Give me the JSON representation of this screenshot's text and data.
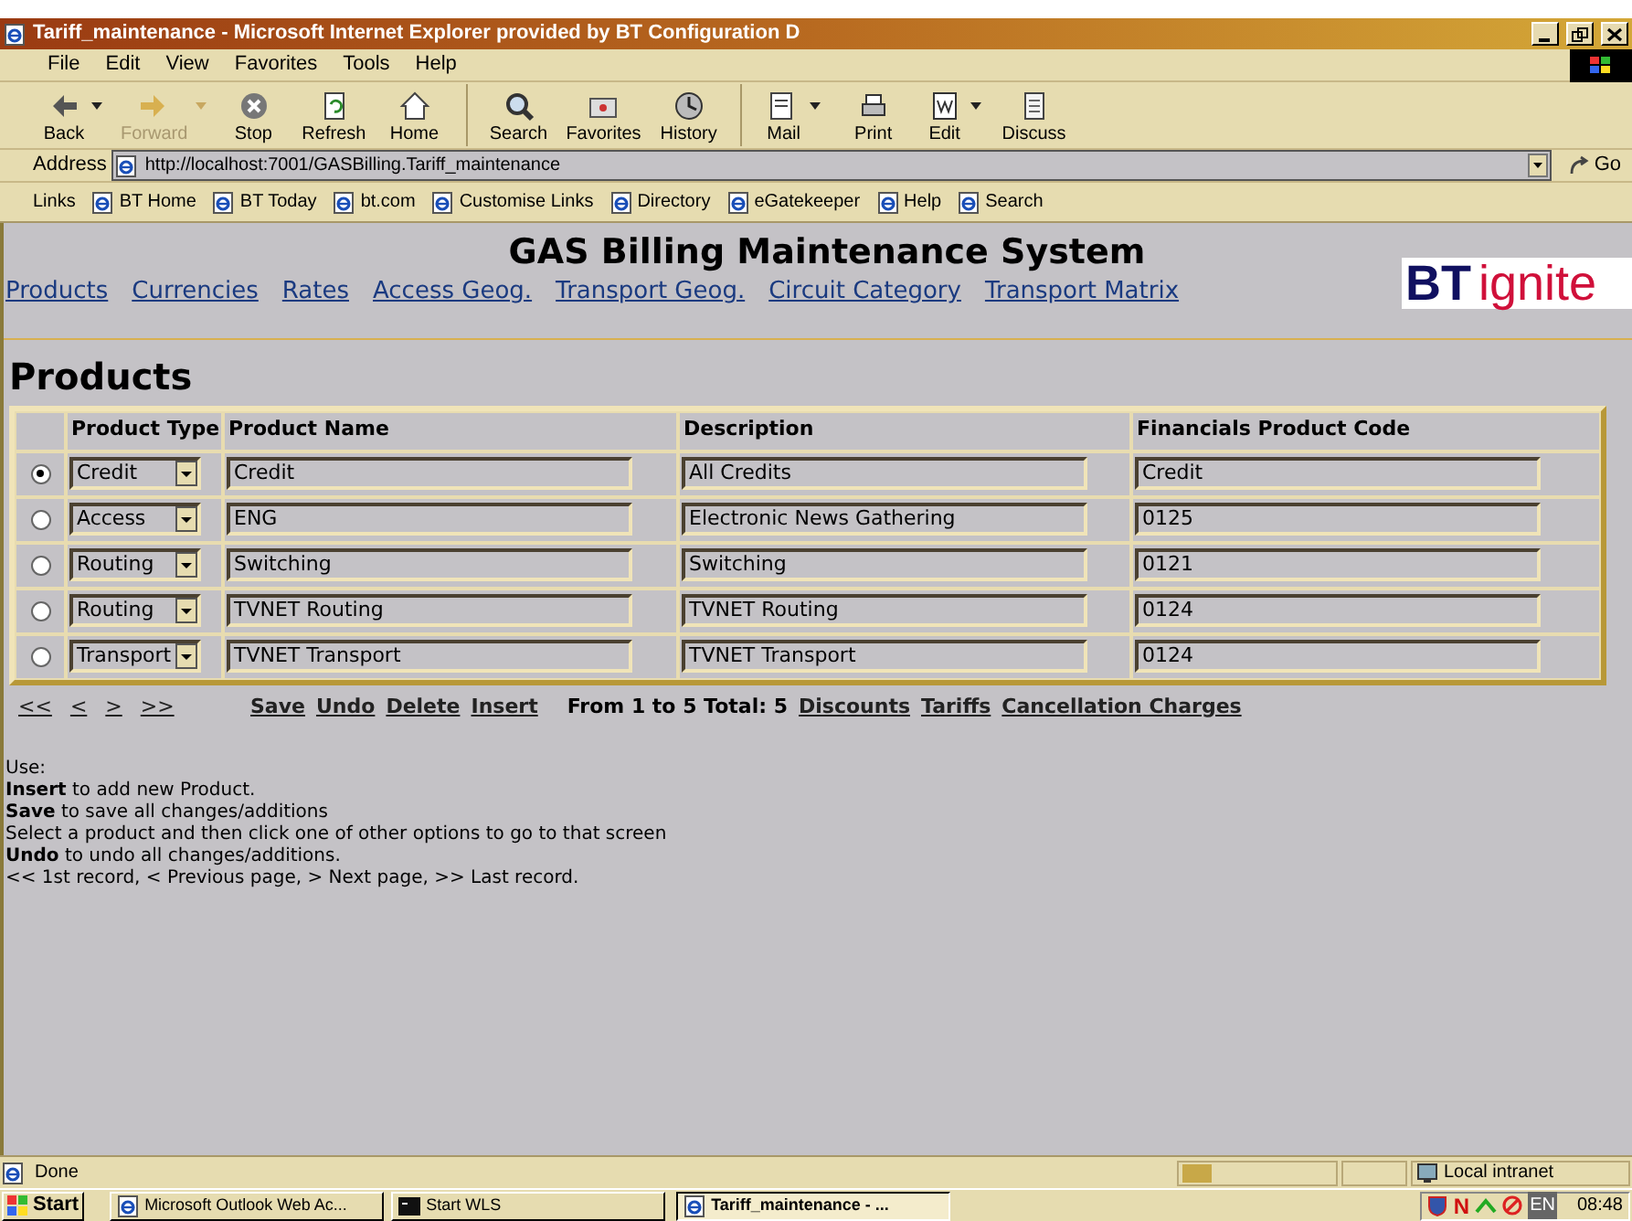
{
  "window": {
    "title": "Tariff_maintenance - Microsoft Internet Explorer provided by BT Configuration D"
  },
  "menu": [
    "File",
    "Edit",
    "View",
    "Favorites",
    "Tools",
    "Help"
  ],
  "toolbar": [
    [
      {
        "label": "Back",
        "disabled": false,
        "dropdown": true
      },
      {
        "label": "Forward",
        "disabled": true,
        "dropdown": true
      },
      {
        "label": "Stop",
        "disabled": false,
        "dropdown": false
      },
      {
        "label": "Refresh",
        "disabled": false,
        "dropdown": false
      },
      {
        "label": "Home",
        "disabled": false,
        "dropdown": false
      }
    ],
    [
      {
        "label": "Search",
        "disabled": false,
        "dropdown": false
      },
      {
        "label": "Favorites",
        "disabled": false,
        "dropdown": false
      },
      {
        "label": "History",
        "disabled": false,
        "dropdown": false
      }
    ],
    [
      {
        "label": "Mail",
        "disabled": false,
        "dropdown": true
      },
      {
        "label": "Print",
        "disabled": false,
        "dropdown": false
      },
      {
        "label": "Edit",
        "disabled": false,
        "dropdown": true
      },
      {
        "label": "Discuss",
        "disabled": false,
        "dropdown": false
      }
    ]
  ],
  "address": {
    "label": "Address",
    "value": "http://localhost:7001/GASBilling.Tariff_maintenance",
    "go": "Go"
  },
  "links": {
    "label": "Links",
    "items": [
      "BT Home",
      "BT Today",
      "bt.com",
      "Customise Links",
      "Directory",
      "eGatekeeper",
      "Help",
      "Search"
    ]
  },
  "page": {
    "heading": "GAS Billing Maintenance System",
    "nav": [
      "Products",
      "Currencies",
      "Rates",
      "Access Geog.",
      "Transport Geog.",
      "Circuit Category",
      "Transport Matrix"
    ],
    "logo": {
      "brand": "BT",
      "product": "ignite"
    },
    "section": "Products",
    "table": {
      "columns": [
        "Product Type",
        "Product Name",
        "Description",
        "Financials Product Code"
      ],
      "rows": [
        {
          "selected": true,
          "type": "Credit",
          "name": "Credit",
          "description": "All Credits",
          "code": "Credit"
        },
        {
          "selected": false,
          "type": "Access",
          "name": "ENG",
          "description": "Electronic News Gathering",
          "code": "0125"
        },
        {
          "selected": false,
          "type": "Routing",
          "name": "Switching",
          "description": "Switching",
          "code": "0121"
        },
        {
          "selected": false,
          "type": "Routing",
          "name": "TVNET Routing",
          "description": "TVNET Routing",
          "code": "0124"
        },
        {
          "selected": false,
          "type": "Transport",
          "name": "TVNET Transport",
          "description": "TVNET Transport",
          "code": "0124"
        }
      ]
    },
    "pager": [
      "<<",
      "<",
      ">",
      ">>"
    ],
    "actions": [
      "Save",
      "Undo",
      "Delete",
      "Insert"
    ],
    "record_info": "From 1 to 5 Total: 5",
    "related": [
      "Discounts",
      "Tariffs",
      "Cancellation Charges"
    ],
    "help": [
      "Use:",
      "**Insert** to add new Product.",
      "**Save** to save all changes/additions",
      "Select a product and then click one of other options to go to that screen",
      "**Undo** to undo all changes/additions.",
      "<< 1st record, < Previous page, > Next page, >> Last record."
    ]
  },
  "status_bar": {
    "text": "Done",
    "level": 0.2,
    "zone": "Local intranet"
  },
  "taskbar": {
    "start": "Start",
    "tasks": [
      {
        "label": "Microsoft Outlook Web Ac...",
        "selected": false
      },
      {
        "label": "Start WLS",
        "selected": false
      },
      {
        "label": "Tariff_maintenance - ...",
        "selected": true
      }
    ],
    "tray_lang": "EN",
    "tray_mark": "N",
    "clock": "08:48"
  }
}
